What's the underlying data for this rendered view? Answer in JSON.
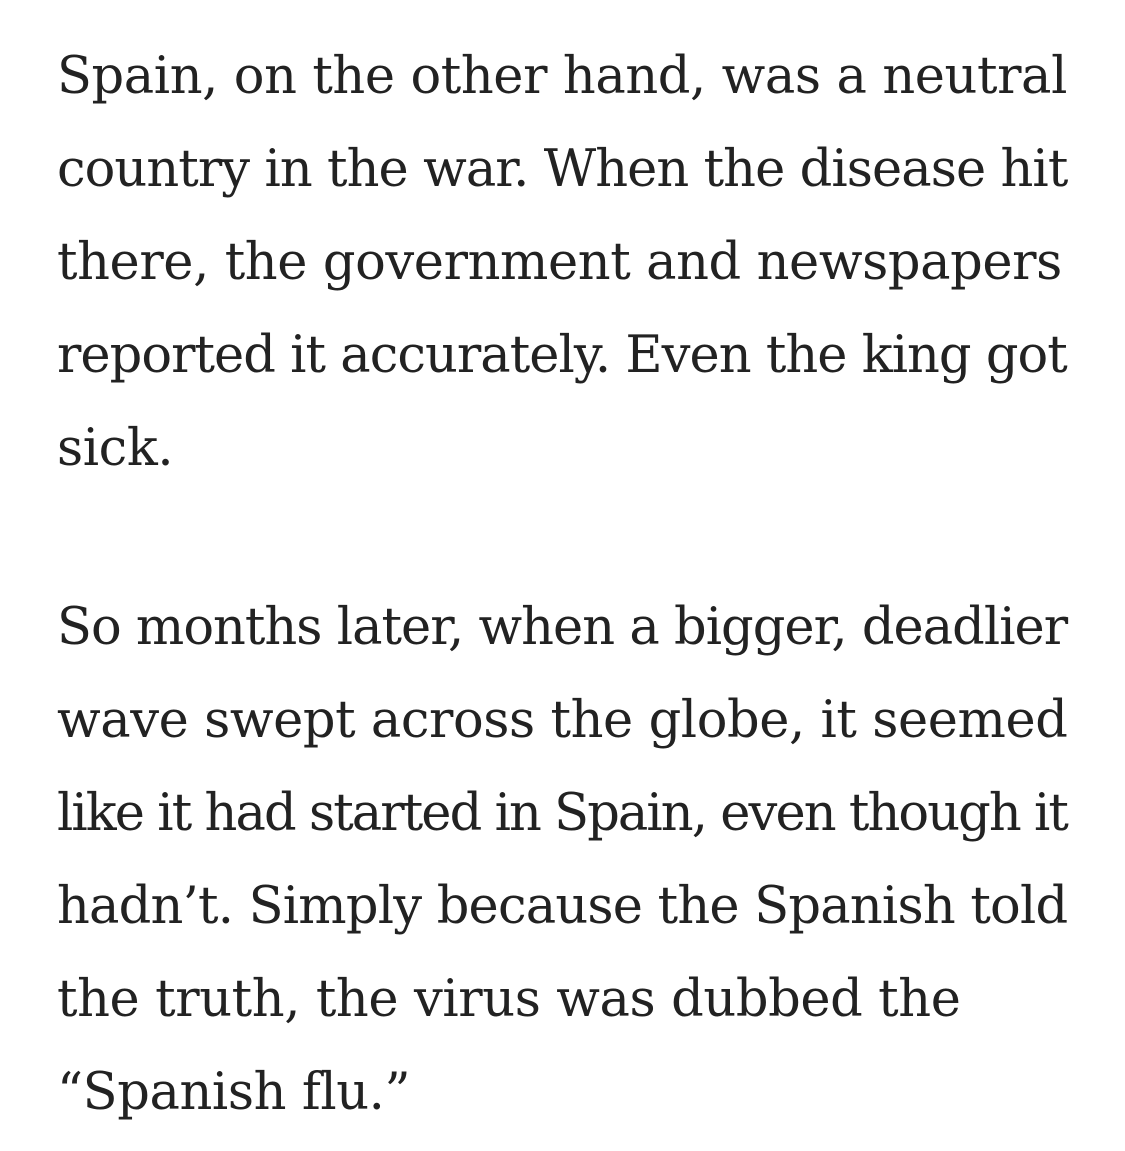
{
  "article": {
    "paragraphs": [
      {
        "lines": [
          "Spain, on the other hand, was a neutral",
          "country in the war. When the disease hit",
          "there, the government and newspapers",
          "reported it accurately. Even the king got",
          "sick."
        ]
      },
      {
        "lines": [
          "So months later, when a bigger, deadlier",
          "wave swept across the globe, it seemed",
          "like it had started in Spain, even though it",
          "hadn’t. Simply because the Spanish told",
          "the truth, the virus was dubbed the",
          "“Spanish flu.”"
        ]
      }
    ]
  }
}
